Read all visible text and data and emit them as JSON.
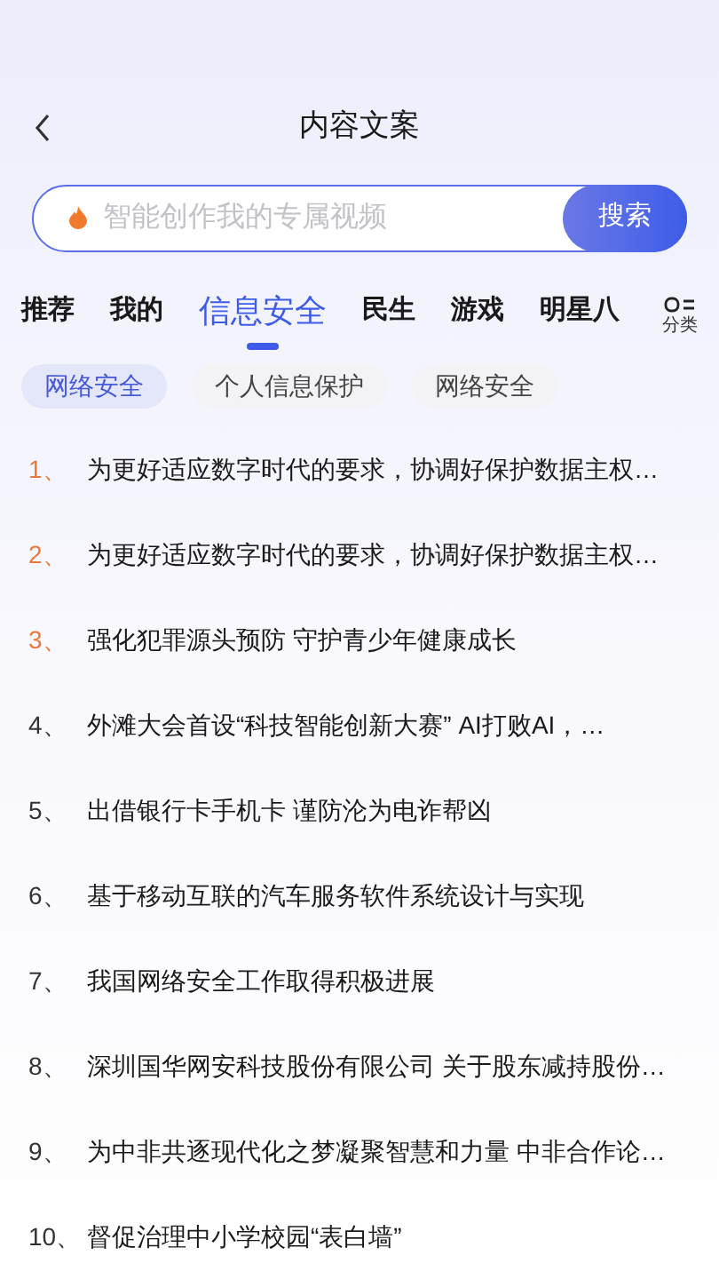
{
  "header": {
    "title": "内容文案"
  },
  "search": {
    "placeholder": "智能创作我的专属视频",
    "button": "搜索"
  },
  "tabs": [
    {
      "label": "推荐",
      "selected": false
    },
    {
      "label": "我的",
      "selected": false
    },
    {
      "label": "信息安全",
      "selected": true
    },
    {
      "label": "民生",
      "selected": false
    },
    {
      "label": "游戏",
      "selected": false
    },
    {
      "label": "明星八",
      "selected": false
    }
  ],
  "category_button": "分类",
  "chips": [
    {
      "label": "网络安全",
      "selected": true
    },
    {
      "label": "个人信息保护",
      "selected": false
    },
    {
      "label": "网络安全",
      "selected": false
    }
  ],
  "items": [
    {
      "number": "1、",
      "title": "为更好适应数字时代的要求，协调好保护数据主权…",
      "hot": true
    },
    {
      "number": "2、",
      "title": "为更好适应数字时代的要求，协调好保护数据主权…",
      "hot": true
    },
    {
      "number": "3、",
      "title": "强化犯罪源头预防 守护青少年健康成长",
      "hot": true
    },
    {
      "number": "4、",
      "title": "外滩大会首设“科技智能创新大赛” AI打败AI，…",
      "hot": false
    },
    {
      "number": "5、",
      "title": "出借银行卡手机卡 谨防沦为电诈帮凶",
      "hot": false
    },
    {
      "number": "6、",
      "title": "基于移动互联的汽车服务软件系统设计与实现",
      "hot": false
    },
    {
      "number": "7、",
      "title": "我国网络安全工作取得积极进展",
      "hot": false
    },
    {
      "number": "8、",
      "title": "深圳国华网安科技股份有限公司 关于股东减持股份…",
      "hot": false
    },
    {
      "number": "9、",
      "title": "为中非共逐现代化之梦凝聚智慧和力量 中非合作论…",
      "hot": false
    },
    {
      "number": "10、",
      "title": "督促治理中小学校园“表白墙”",
      "hot": false
    }
  ]
}
